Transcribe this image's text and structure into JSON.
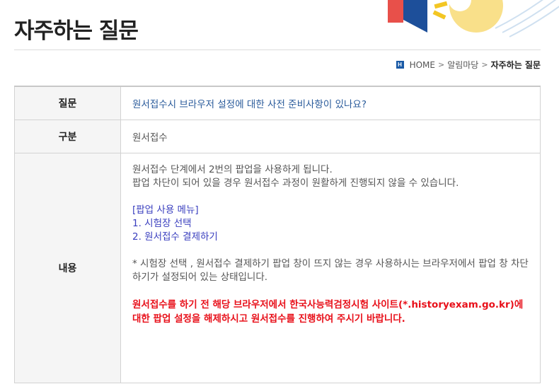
{
  "header": {
    "title": "자주하는 질문",
    "deco_colors": [
      "#e8504a",
      "#1d4f9a",
      "#f3c623",
      "#f9e08a"
    ]
  },
  "breadcrumb": {
    "home": "HOME",
    "level1": "알림마당",
    "current": "자주하는 질문"
  },
  "table": {
    "question_label": "질문",
    "question_text": "원서접수시 브라우저 설정에 대한 사전 준비사항이 있나요?",
    "category_label": "구분",
    "category_text": "원서접수",
    "content_label": "내용",
    "content": {
      "line1": "원서접수 단계에서 2번의 팝업을 사용하게 됩니다.",
      "line2": "팝업 차단이 되어 있을 경우 원서접수 과정이 원활하게 진행되지 않을 수 있습니다.",
      "menu_title": "[팝업 사용 메뉴]",
      "menu_item1": "1. 시험장 선택",
      "menu_item2": "2. 원서접수 결제하기",
      "note": "* 시험장 선택 , 원서접수 결제하기  팝업 창이 뜨지 않는 경우 사용하시는 브라우저에서 팝업 창 차단하기가 설정되어 있는 상태입니다.",
      "red_note": "원서접수를 하기 전 해당 브라우저에서 한국사능력검정시험 사이트(*.historyexam.go.kr)에 대한 팝업 설정을 해제하시고 원서접수를 진행하여 주시기 바랍니다."
    }
  }
}
